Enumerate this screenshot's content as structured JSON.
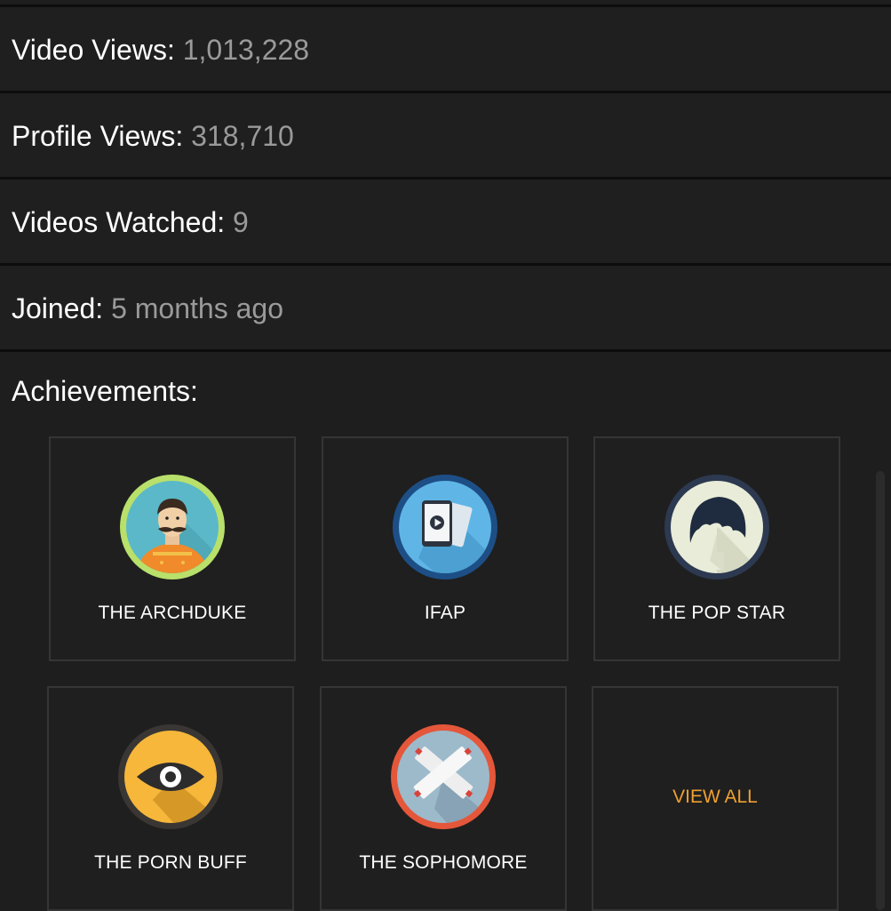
{
  "stats": [
    {
      "label": "Video Views:",
      "value": "1,013,228"
    },
    {
      "label": "Profile Views:",
      "value": "318,710"
    },
    {
      "label": "Videos Watched:",
      "value": "9"
    },
    {
      "label": "Joined:",
      "value": "5 months ago"
    }
  ],
  "achievements": {
    "title": "Achievements:",
    "items": [
      {
        "label": "THE ARCHDUKE",
        "icon": "archduke-portrait-icon"
      },
      {
        "label": "IFAP",
        "icon": "tablet-play-icon"
      },
      {
        "label": "THE POP STAR",
        "icon": "pop-star-hair-icon"
      },
      {
        "label": "THE PORN BUFF",
        "icon": "eye-icon"
      },
      {
        "label": "THE SOPHOMORE",
        "icon": "crossed-bandage-icon"
      }
    ],
    "view_all": "VIEW ALL"
  },
  "colors": {
    "background": "#1e1e1e",
    "value_text": "#9a9a9a",
    "accent": "#f0a030"
  }
}
